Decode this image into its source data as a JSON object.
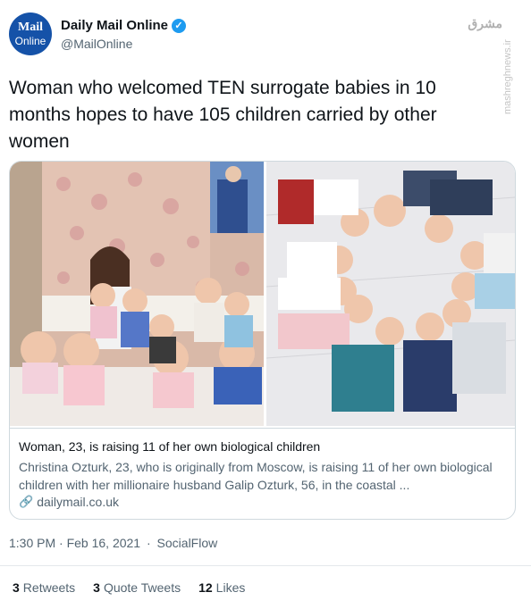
{
  "tweet": {
    "avatar_line1": "Mail",
    "avatar_line2": "Online",
    "display_name": "Daily Mail Online",
    "verified_icon": "✓",
    "handle": "@MailOnline",
    "text": "Woman who welcomed TEN surrogate babies in 10 months hopes to have 105 children carried by other women",
    "timestamp": "1:30 PM · Feb 16, 2021",
    "source_sep": "·",
    "source": "SocialFlow"
  },
  "watermark": {
    "logo": "ﻣﺸﺮﻕ",
    "text": "mashreghnews.ir"
  },
  "card": {
    "title": "Woman, 23, is raising 11 of her own biological children",
    "description": "Christina Ozturk, 23, who is originally from Moscow, is raising 11 of her own biological children with her millionaire husband Galip Ozturk, 56, in the coastal ...",
    "domain": "dailymail.co.uk",
    "link_icon": "🔗"
  },
  "stats": {
    "retweets_count": "3",
    "retweets_label": "Retweets",
    "quotes_count": "3",
    "quotes_label": "Quote Tweets",
    "likes_count": "12",
    "likes_label": "Likes"
  },
  "colors": {
    "brand": "#1552a8",
    "verified": "#1d9bf0",
    "secondary_text": "#536471",
    "border": "#cfd9de"
  }
}
